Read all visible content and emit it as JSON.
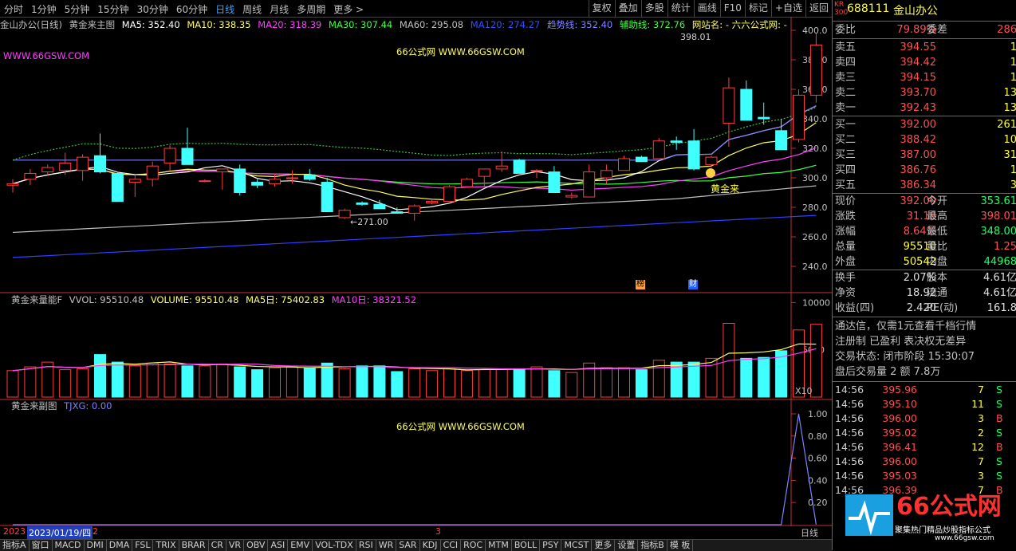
{
  "toolbar": {
    "periods": [
      "分时",
      "1分钟",
      "5分钟",
      "15分钟",
      "30分钟",
      "60分钟",
      "日线",
      "周线",
      "月线",
      "多周期",
      "更多 >"
    ],
    "active_period": "日线",
    "right_tools": [
      "复权",
      "叠加",
      "多股",
      "统计",
      "画线",
      "F10",
      "标记",
      "+自选",
      "返回"
    ]
  },
  "main_legend": {
    "title": "金山办公(日线)",
    "indicator": "黄金来主图",
    "ma5": "MA5: 352.40",
    "ma10": "MA10: 338.35",
    "ma20": "MA20: 318.39",
    "ma30": "MA30: 307.44",
    "ma60": "MA60: 295.08",
    "ma120": "MA120: 274.27",
    "trend": "趋势线: 352.40",
    "aux": "辅助线: 372.76",
    "site": "网站名: - 六六公式网: -"
  },
  "watermarks": {
    "left": "WWW.66GSW.COM",
    "center": "66公式网 WWW.66GSW.COM"
  },
  "annotations": {
    "high": "398.01",
    "low": "271.00",
    "gold": "黄金来",
    "bang": "榜",
    "cai": "财"
  },
  "price_axis": [
    "400.0",
    "380.0",
    "360.0",
    "340.0",
    "320.0",
    "300.0",
    "280.0",
    "260.0",
    "240.0"
  ],
  "vol_legend": {
    "name": "黄金来量能F",
    "vvol": "VVOL: 95510.48",
    "volume": "VOLUME: 95510.48",
    "ma5": "MA5日: 75402.83",
    "ma10": "MA10日: 38321.52"
  },
  "vol_axis": [
    "10000",
    "5000"
  ],
  "vol_unit": "X10",
  "sub_legend": {
    "name": "黄金来副图",
    "tjxg": "TJXG: 0.00"
  },
  "sub_axis": [
    "1.00",
    "0.80",
    "0.60",
    "0.40",
    "0.20"
  ],
  "date_axis": {
    "year": "2023",
    "date": "2023/01/19/四",
    "m2": "2",
    "m3": "3",
    "period": "日线"
  },
  "bottom_tabs": [
    "指标A",
    "窗口",
    "MACD",
    "DMI",
    "DMA",
    "FSL",
    "TRIX",
    "BRAR",
    "CR",
    "VR",
    "OBV",
    "ASI",
    "EMV",
    "VOL-TDX",
    "RSI",
    "WR",
    "SAR",
    "KDJ",
    "CCI",
    "ROC",
    "MTM",
    "BOLL",
    "PSY",
    "MCST",
    "更多",
    "设置",
    "指标B",
    "模 板"
  ],
  "colors": {
    "up": "#ff3c3c",
    "down": "#40ffff",
    "ma5": "#ffffff",
    "ma10": "#ffff60",
    "ma20": "#ff40ff",
    "ma30": "#40ff40",
    "ma60": "#c0c0c0",
    "ma120": "#3040ff",
    "trend": "#8080ff",
    "aux": "#40c040"
  },
  "chart_data": {
    "type": "candlestick",
    "candles": [
      [
        295,
        299,
        290,
        296
      ],
      [
        299,
        306,
        295,
        303
      ],
      [
        304,
        309,
        301,
        307
      ],
      [
        305,
        317,
        302,
        310
      ],
      [
        305,
        316,
        298,
        314
      ],
      [
        315,
        330,
        303,
        304
      ],
      [
        303,
        304,
        284,
        284
      ],
      [
        297,
        302,
        287,
        299
      ],
      [
        299,
        311,
        294,
        308
      ],
      [
        310,
        322,
        305,
        320
      ],
      [
        320,
        334,
        309,
        309
      ],
      [
        298,
        299,
        297,
        298
      ],
      [
        304,
        306,
        292,
        306
      ],
      [
        306,
        309,
        288,
        290
      ],
      [
        297,
        299,
        293,
        295
      ],
      [
        296,
        303,
        294,
        299
      ],
      [
        300,
        305,
        296,
        300
      ],
      [
        302,
        306,
        298,
        299
      ],
      [
        297,
        300,
        277,
        277
      ],
      [
        273,
        279,
        272,
        278
      ],
      [
        283,
        284,
        281,
        282
      ],
      [
        282,
        285,
        279,
        279
      ],
      [
        277,
        280,
        276,
        276
      ],
      [
        276,
        282,
        271,
        281
      ],
      [
        283,
        285,
        282,
        284
      ],
      [
        284,
        295,
        284,
        294
      ],
      [
        294,
        300,
        294,
        299
      ],
      [
        301,
        305,
        293,
        306
      ],
      [
        306,
        318,
        304,
        308
      ],
      [
        312,
        313,
        303,
        303
      ],
      [
        305,
        306,
        300,
        305
      ],
      [
        304,
        308,
        292,
        290
      ],
      [
        287,
        290,
        286,
        288
      ],
      [
        287,
        309,
        287,
        304
      ],
      [
        300,
        309,
        296,
        305
      ],
      [
        305,
        315,
        305,
        313
      ],
      [
        314,
        315,
        312,
        311
      ],
      [
        313,
        327,
        313,
        325
      ],
      [
        325,
        328,
        319,
        324
      ],
      [
        325,
        333,
        305,
        306
      ],
      [
        309,
        315,
        307,
        314
      ],
      [
        337,
        368,
        321,
        361
      ],
      [
        360,
        366,
        339,
        339
      ],
      [
        341,
        351,
        336,
        340
      ],
      [
        332,
        340,
        320,
        319
      ],
      [
        326,
        360,
        324,
        356
      ],
      [
        356,
        398,
        351,
        390
      ]
    ],
    "volume": [
      2800,
      3200,
      3700,
      2900,
      3000,
      4500,
      3700,
      3300,
      3600,
      3500,
      3300,
      3300,
      3500,
      3200,
      2900,
      3100,
      3200,
      3100,
      3600,
      3000,
      3300,
      3300,
      2700,
      3000,
      2800,
      3100,
      2800,
      2900,
      3000,
      3000,
      3200,
      2800,
      2600,
      3600,
      3100,
      3100,
      2900,
      3900,
      3700,
      3700,
      4100,
      7800,
      4100,
      4200,
      4900,
      7100,
      7700
    ],
    "tjxg_peak_index": 45
  },
  "quote": {
    "code": "688111",
    "name": "金山办公",
    "badge_top": "KR",
    "badge_bot": "300",
    "weibi_label": "委比",
    "weibi": "79.89%",
    "weicha_label": "委差",
    "weicha": "286",
    "asks": [
      {
        "l": "卖五",
        "p": "394.55",
        "v": "1"
      },
      {
        "l": "卖四",
        "p": "394.42",
        "v": "1"
      },
      {
        "l": "卖三",
        "p": "394.15",
        "v": "1"
      },
      {
        "l": "卖二",
        "p": "393.70",
        "v": "13"
      },
      {
        "l": "卖一",
        "p": "392.43",
        "v": "13"
      }
    ],
    "bids": [
      {
        "l": "买一",
        "p": "392.00",
        "v": "261"
      },
      {
        "l": "买二",
        "p": "388.42",
        "v": "10"
      },
      {
        "l": "买三",
        "p": "387.00",
        "v": "31"
      },
      {
        "l": "买四",
        "p": "386.76",
        "v": "1"
      },
      {
        "l": "买五",
        "p": "386.34",
        "v": "3"
      }
    ],
    "stats": [
      {
        "l": "现价",
        "v": "392.00",
        "vc": "red",
        "l2": "今开",
        "v2": "353.61",
        "v2c": "green"
      },
      {
        "l": "涨跌",
        "v": "31.18",
        "vc": "red",
        "l2": "最高",
        "v2": "398.01",
        "v2c": "red"
      },
      {
        "l": "涨幅",
        "v": "8.64%",
        "vc": "red",
        "l2": "最低",
        "v2": "348.00",
        "v2c": "green"
      },
      {
        "l": "总量",
        "v": "95510",
        "vc": "yellow",
        "l2": "量比",
        "v2": "1.25",
        "v2c": "red"
      },
      {
        "l": "外盘",
        "v": "50542",
        "vc": "yellow",
        "l2": "内盘",
        "v2": "44968",
        "v2c": "green"
      }
    ],
    "stats2": [
      {
        "l": "换手",
        "v": "2.07%",
        "l2": "股本",
        "v2": "4.61亿"
      },
      {
        "l": "净资",
        "v": "18.92",
        "l2": "流通",
        "v2": "4.61亿"
      },
      {
        "l": "收益(四)",
        "v": "2.420",
        "l2": "PE(动)",
        "v2": "161.8"
      }
    ],
    "promo": "通达信，仅需1元查看千档行情",
    "notice": "注册制 已盈利 表决权无差异",
    "trade_status": "交易状态: 闭市阶段 15:30:07",
    "after_hours": "盘后交易量 2 额 7.8万",
    "ticks": [
      {
        "t": "14:56",
        "p": "395.96",
        "q": "7",
        "s": "S"
      },
      {
        "t": "14:56",
        "p": "395.10",
        "q": "11",
        "s": "S"
      },
      {
        "t": "14:56",
        "p": "396.00",
        "q": "3",
        "s": "B"
      },
      {
        "t": "14:56",
        "p": "395.02",
        "q": "2",
        "s": "S"
      },
      {
        "t": "14:56",
        "p": "396.41",
        "q": "12",
        "s": "B"
      },
      {
        "t": "14:56",
        "p": "396.00",
        "q": "7",
        "s": "S"
      },
      {
        "t": "14:56",
        "p": "395.03",
        "q": "3",
        "s": "S"
      },
      {
        "t": "14:56",
        "p": "396.39",
        "q": "7",
        "s": "B"
      }
    ],
    "logo": "66公式网",
    "logo_sub": "聚集热门精品炒股指标公式",
    "logo_url": "www.66gsw.com"
  }
}
